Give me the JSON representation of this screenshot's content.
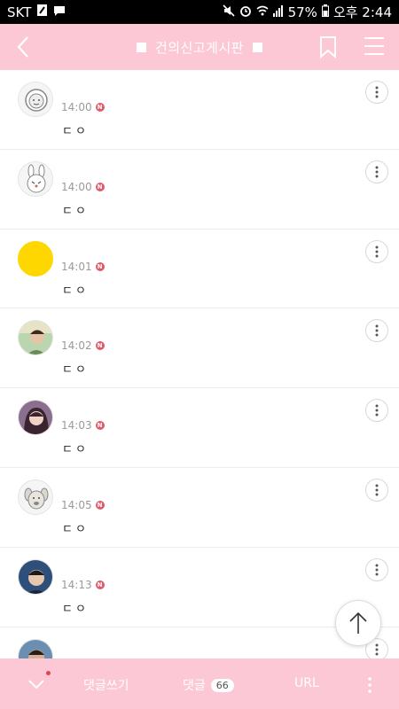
{
  "status_bar": {
    "carrier": "SKT",
    "battery": "57%",
    "time": "오후 2:44",
    "icons": [
      "edit-icon",
      "chat-icon",
      "mute-icon",
      "alarm-icon",
      "wifi-icon",
      "signal-icon",
      "battery-icon"
    ]
  },
  "header": {
    "title": "건의신고게시판",
    "color": "#fcc8d5",
    "icons": [
      "back-icon",
      "bookmark-icon",
      "menu-icon"
    ]
  },
  "new_badge": "N",
  "comments": [
    {
      "time": "14:00",
      "text": "ㄷㅇ",
      "avatar": "gray-character"
    },
    {
      "time": "14:00",
      "text": "ㄷㅇ",
      "avatar": "rabbit-character"
    },
    {
      "time": "14:01",
      "text": "ㄷㅇ",
      "avatar": "yellow-circle"
    },
    {
      "time": "14:02",
      "text": "ㄷㅇ",
      "avatar": "photo-man"
    },
    {
      "time": "14:03",
      "text": "ㄷㅇ",
      "avatar": "photo-woman"
    },
    {
      "time": "14:05",
      "text": "ㄷㅇ",
      "avatar": "dog-character"
    },
    {
      "time": "14:13",
      "text": "ㄷㅇ",
      "avatar": "photo-man-2"
    },
    {
      "time": "",
      "text": "",
      "avatar": "photo-man-3"
    }
  ],
  "bottom_bar": {
    "write_label": "댓글쓰기",
    "comments_label": "댓글",
    "comments_count": "66",
    "url_label": "URL"
  }
}
